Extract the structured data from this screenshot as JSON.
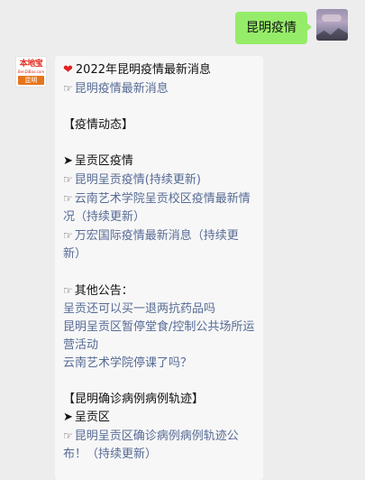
{
  "outgoing": {
    "text": "昆明疫情"
  },
  "bot": {
    "logo_text": "本地宝",
    "logo_url": "BenDiBao.com",
    "city_tag": "昆明"
  },
  "message": {
    "title": "2022年昆明疫情最新消息",
    "title_link": "昆明疫情最新消息",
    "section1_header": "【疫情动态】",
    "district1": "呈贡区疫情",
    "links1": [
      "昆明呈贡疫情(持续更新)",
      "云南艺术学院呈贡校区疫情最新情况（持续更新）",
      "万宏国际疫情最新消息（持续更新）"
    ],
    "notice_header": "其他公告：",
    "notice_links": [
      "呈贡还可以买一退两抗药品吗",
      "昆明呈贡区暂停堂食/控制公共场所运营活动",
      "云南艺术学院停课了吗？"
    ],
    "section2_header": "【昆明确诊病例病例轨迹】",
    "district2": "呈贡区",
    "links2": [
      "昆明呈贡区确诊病例病例轨迹公布！（持续更新）"
    ]
  }
}
